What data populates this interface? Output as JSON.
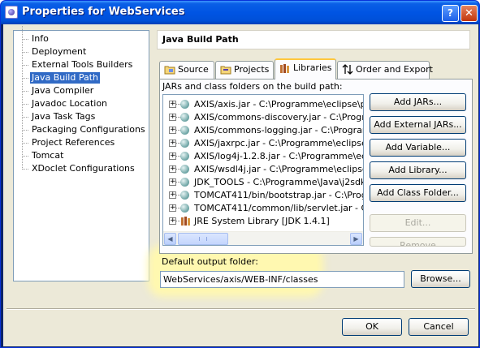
{
  "window": {
    "title": "Properties for WebServices",
    "help_label": "?",
    "close_label": "✕"
  },
  "nav": {
    "items": [
      {
        "label": "Info",
        "selected": false
      },
      {
        "label": "Deployment",
        "selected": false
      },
      {
        "label": "External Tools Builders",
        "selected": false
      },
      {
        "label": "Java Build Path",
        "selected": true
      },
      {
        "label": "Java Compiler",
        "selected": false
      },
      {
        "label": "Javadoc Location",
        "selected": false
      },
      {
        "label": "Java Task Tags",
        "selected": false
      },
      {
        "label": "Packaging Configurations",
        "selected": false
      },
      {
        "label": "Project References",
        "selected": false
      },
      {
        "label": "Tomcat",
        "selected": false
      },
      {
        "label": "XDoclet Configurations",
        "selected": false
      }
    ]
  },
  "page": {
    "title": "Java Build Path"
  },
  "tabs": [
    {
      "label": "Source",
      "icon": "source-folder-icon",
      "active": false
    },
    {
      "label": "Projects",
      "icon": "projects-icon",
      "active": false
    },
    {
      "label": "Libraries",
      "icon": "libraries-icon",
      "active": true
    },
    {
      "label": "Order and Export",
      "icon": "order-export-icon",
      "active": false
    }
  ],
  "libraries": {
    "list_label": "JARs and class folders on the build path:",
    "entries": [
      {
        "label": "AXIS/axis.jar - C:\\Programme\\eclipse\\plugin",
        "icon": "jar-icon"
      },
      {
        "label": "AXIS/commons-discovery.jar - C:\\Programm",
        "icon": "jar-icon"
      },
      {
        "label": "AXIS/commons-logging.jar - C:\\Programme\\",
        "icon": "jar-icon"
      },
      {
        "label": "AXIS/jaxrpc.jar - C:\\Programme\\eclipse\\plu",
        "icon": "jar-icon"
      },
      {
        "label": "AXIS/log4j-1.2.8.jar - C:\\Programme\\eclipse",
        "icon": "jar-icon"
      },
      {
        "label": "AXIS/wsdl4j.jar - C:\\Programme\\eclipse\\plu",
        "icon": "jar-icon"
      },
      {
        "label": "JDK_TOOLS - C:\\Programme\\Java\\j2sdk1.4",
        "icon": "jar-icon"
      },
      {
        "label": "TOMCAT411/bin/bootstrap.jar - C:\\Program",
        "icon": "jar-icon"
      },
      {
        "label": "TOMCAT411/common/lib/servlet.jar - C:\\Pro",
        "icon": "jar-icon"
      },
      {
        "label": "JRE System Library [JDK 1.4.1]",
        "icon": "library-icon"
      }
    ],
    "buttons": {
      "add_jars": "Add JARs...",
      "add_external_jars": "Add External JARs...",
      "add_variable": "Add Variable...",
      "add_library": "Add Library...",
      "add_class_folder": "Add Class Folder...",
      "edit": "Edit...",
      "remove": "Remove"
    }
  },
  "output": {
    "label": "Default output folder:",
    "value": "WebServices/axis/WEB-INF/classes",
    "browse": "Browse..."
  },
  "footer": {
    "ok": "OK",
    "cancel": "Cancel"
  },
  "colors": {
    "titlebar": "#0054e3",
    "selection": "#316ac5",
    "highlight": "#fff8b0",
    "active_tab_accent": "#ffc73c"
  }
}
